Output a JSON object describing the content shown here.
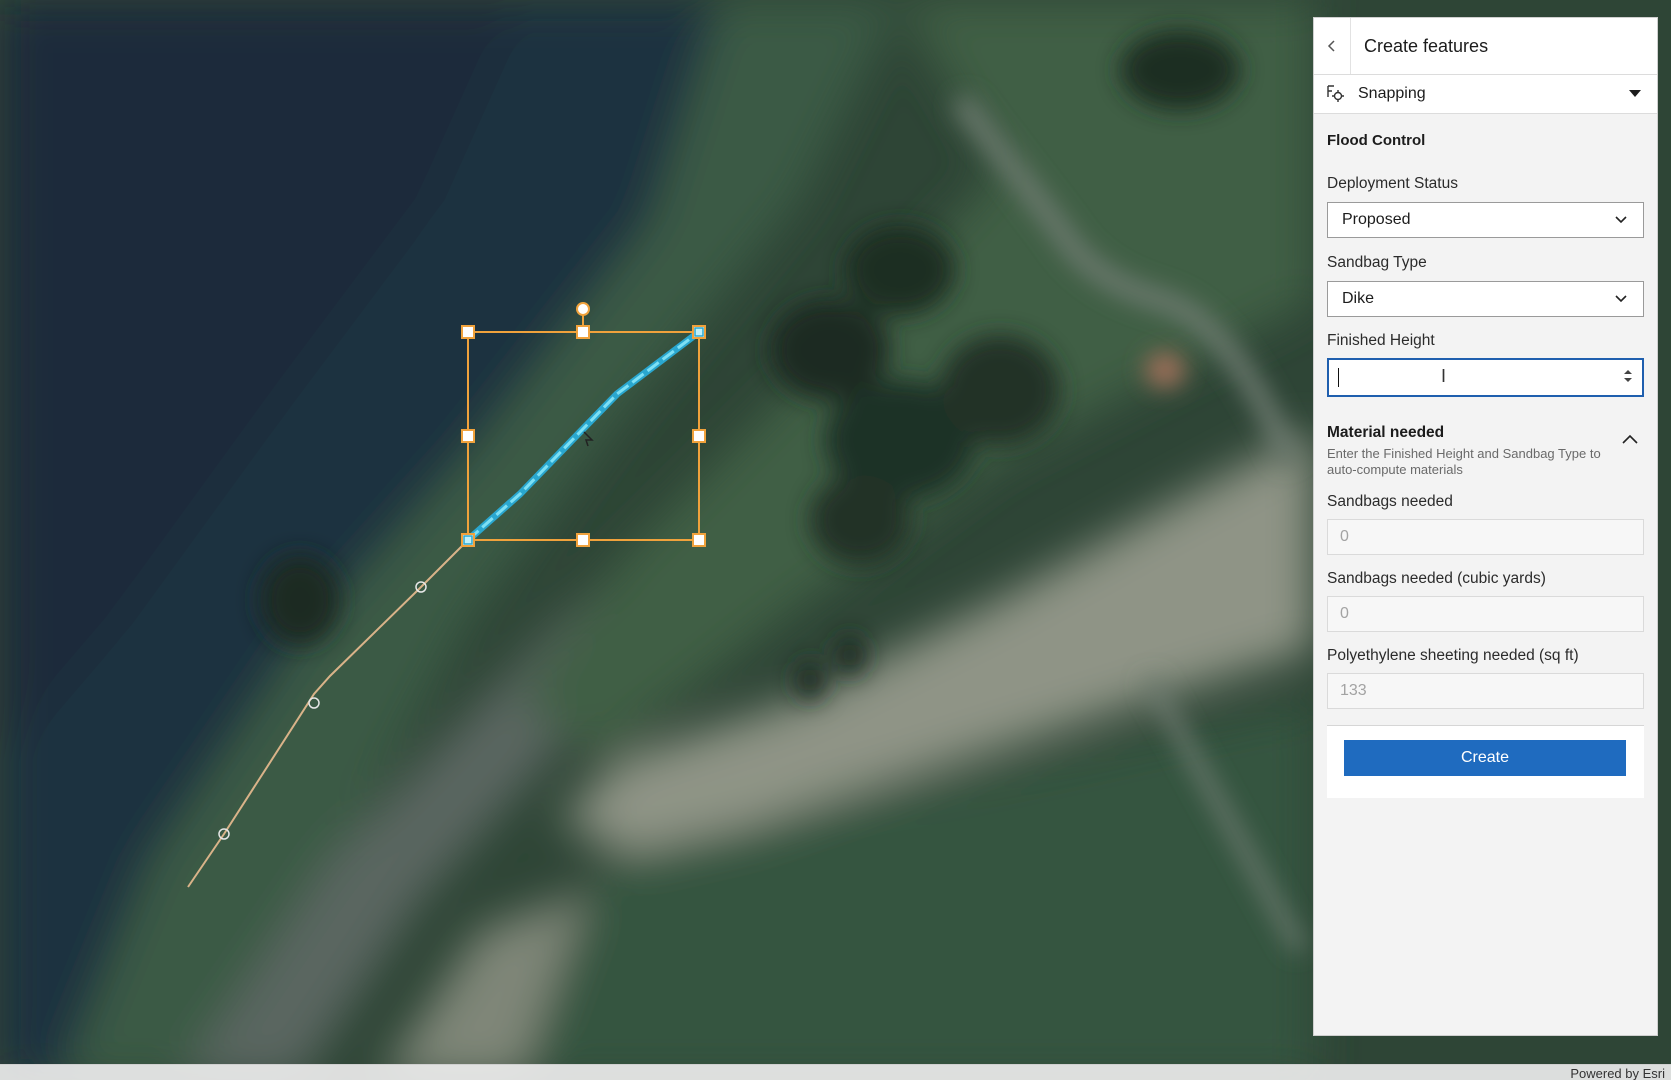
{
  "panel": {
    "title": "Create features",
    "back_icon": "chevron-left-icon",
    "snapping": {
      "label": "Snapping",
      "icon": "snapping-icon"
    },
    "group_title": "Flood Control",
    "fields": {
      "deployment_status": {
        "label": "Deployment Status",
        "value": "Proposed"
      },
      "sandbag_type": {
        "label": "Sandbag Type",
        "value": "Dike"
      },
      "finished_height": {
        "label": "Finished Height",
        "value": ""
      }
    },
    "material": {
      "title": "Material needed",
      "description": "Enter the Finished Height and Sandbag Type to auto-compute materials",
      "sandbags_needed": {
        "label": "Sandbags needed",
        "value": "0"
      },
      "sandbags_cubic": {
        "label": "Sandbags needed (cubic yards)",
        "value": "0"
      },
      "polyethylene": {
        "label": "Polyethylene sheeting needed (sq ft)",
        "value": "133"
      }
    },
    "create_label": "Create"
  },
  "map": {
    "attribution": "Powered by Esri",
    "colors": {
      "selection": "#f0a23c",
      "feature_line": "#3fc1e6",
      "guide_line": "#d9b389"
    }
  }
}
